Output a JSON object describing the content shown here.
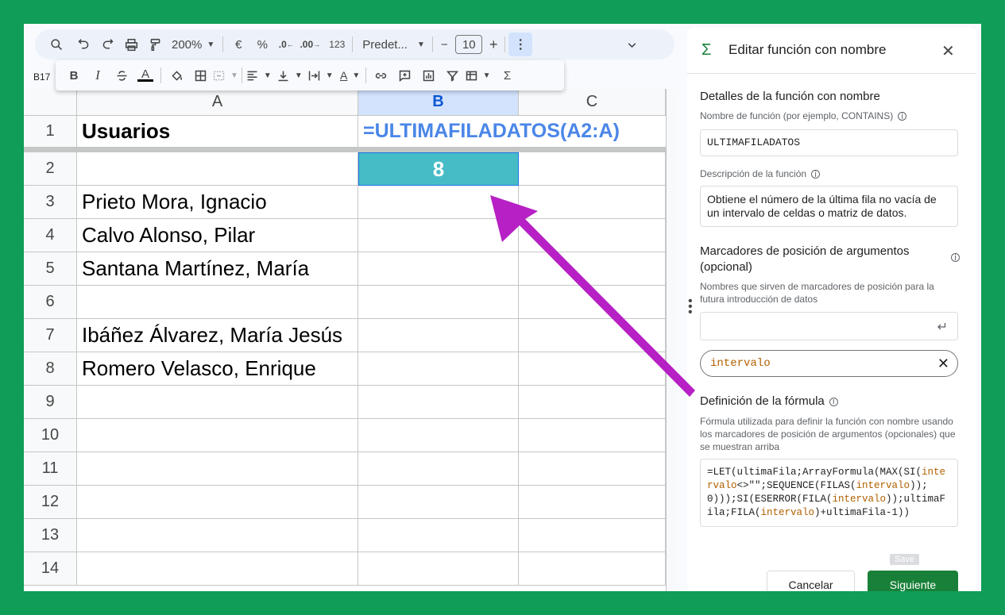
{
  "toolbar": {
    "zoom": "200%",
    "currency": "€",
    "percent": "%",
    "dec_decrease": ".0",
    "dec_increase": ".00",
    "number_format": "123",
    "font": "Predet...",
    "font_size": "10",
    "minus": "−",
    "plus": "+"
  },
  "format_bar": {
    "bold": "B",
    "italic": "I",
    "text_color": "A",
    "text_rotate": "A",
    "functions": "Σ"
  },
  "name_box": "B17",
  "columns": [
    "A",
    "B",
    "C"
  ],
  "rows": [
    "1",
    "2",
    "3",
    "4",
    "5",
    "6",
    "7",
    "8",
    "9",
    "10",
    "11",
    "12",
    "13",
    "14"
  ],
  "cells": {
    "A1": "Usuarios",
    "B1": "=ULTIMAFILADATOS(A2:A)",
    "B2": "8",
    "A3": "Prieto Mora, Ignacio",
    "A4": "Calvo Alonso, Pilar",
    "A5": "Santana Martínez, María",
    "A7": "Ibáñez Álvarez, María Jesús",
    "A8": "Romero Velasco, Enrique"
  },
  "colors": {
    "accent": "#188038",
    "highlight_cell": "#46bdc6",
    "arrow": "#b620c4",
    "formula": "#4a86e8",
    "background": "#0f9d58"
  },
  "panel": {
    "title": "Editar función con nombre",
    "details_heading": "Detalles de la función con nombre",
    "name_label": "Nombre de función (por ejemplo, CONTAINS)",
    "name_value": "ULTIMAFILADATOS",
    "desc_label": "Descripción de la función",
    "desc_value": "Obtiene el número de la última fila no vacía de un intervalo de celdas o matriz de datos.",
    "args_heading_1": "Marcadores de posición de argumentos",
    "args_heading_2": "(opcional)",
    "args_desc": "Nombres que sirven de marcadores de posición para la futura introducción de datos",
    "arg_input_value": "",
    "arg_chip": "intervalo",
    "def_heading": "Definición de la fórmula",
    "def_desc": "Fórmula utilizada para definir la función con nombre usando los marcadores de posición de argumentos (opcionales) que se muestran arriba",
    "formula_parts": [
      {
        "t": "=LET(ultimaFila;ArrayFormula(MAX(SI(",
        "arg": false
      },
      {
        "t": "intervalo",
        "arg": true
      },
      {
        "t": "<>\"\";SEQUENCE(FILAS(",
        "arg": false
      },
      {
        "t": "intervalo",
        "arg": true
      },
      {
        "t": "));0)));SI(ESERROR(FILA(",
        "arg": false
      },
      {
        "t": "intervalo",
        "arg": true
      },
      {
        "t": "));ultimaFila;FILA(",
        "arg": false
      },
      {
        "t": "intervalo",
        "arg": true
      },
      {
        "t": ")+ultimaFila-1))",
        "arg": false
      }
    ],
    "save_tag": "Save",
    "cancel": "Cancelar",
    "next": "Siguiente"
  }
}
